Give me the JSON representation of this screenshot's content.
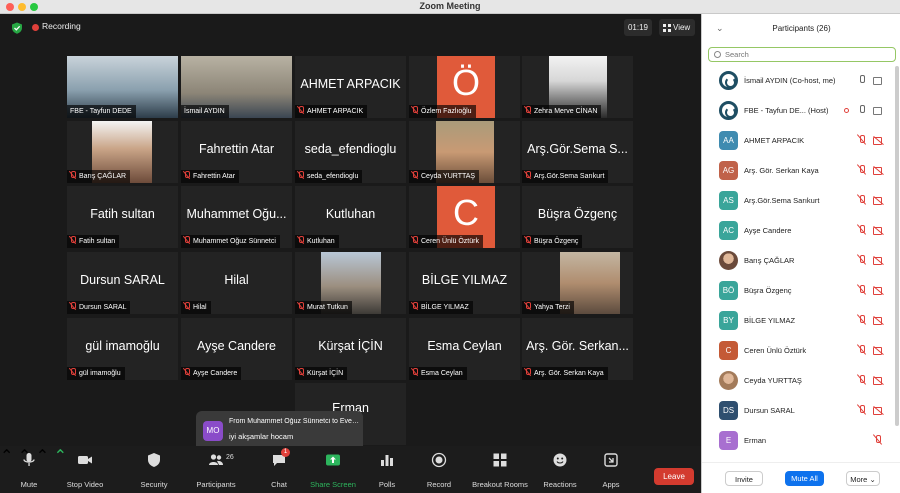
{
  "window": {
    "title": "Zoom Meeting"
  },
  "meeting": {
    "recording_label": "Recording",
    "timer": "01:19",
    "view_label": "View"
  },
  "tiles": [
    {
      "label": "FBE - Tayfun DEDE",
      "big": "",
      "type": "photo",
      "muted": false
    },
    {
      "label": "İsmail AYDIN",
      "big": "",
      "type": "photo",
      "muted": false,
      "speaking": true
    },
    {
      "label": "AHMET ARPACIK",
      "big": "AHMET ARPACIK",
      "type": "name",
      "muted": true
    },
    {
      "label": "Özlem Fazlıoğlu",
      "big": "Ö",
      "type": "letter",
      "muted": true
    },
    {
      "label": "Zehra Merve CİNAN",
      "big": "",
      "type": "photo",
      "muted": true
    },
    {
      "label": "Barış ÇAĞLAR",
      "big": "",
      "type": "photo",
      "muted": true
    },
    {
      "label": "Fahrettin Atar",
      "big": "Fahrettin Atar",
      "type": "name",
      "muted": true
    },
    {
      "label": "seda_efendioglu",
      "big": "seda_efendioglu",
      "type": "name",
      "muted": true
    },
    {
      "label": "Ceyda YURTTAŞ",
      "big": "",
      "type": "photo",
      "muted": true
    },
    {
      "label": "Arş.Gör.Sema Sarıkurt",
      "big": "Arş.Gör.Sema S...",
      "type": "name",
      "muted": true
    },
    {
      "label": "Fatih sultan",
      "big": "Fatih sultan",
      "type": "name",
      "muted": true
    },
    {
      "label": "Muhammet Oğuz Sünnetci",
      "big": "Muhammet Oğu...",
      "type": "name",
      "muted": true
    },
    {
      "label": "Kutluhan",
      "big": "Kutluhan",
      "type": "name",
      "muted": true
    },
    {
      "label": "Ceren Ünlü Öztürk",
      "big": "C",
      "type": "letter",
      "muted": true
    },
    {
      "label": "Büşra Özgenç",
      "big": "Büşra Özgenç",
      "type": "name",
      "muted": true
    },
    {
      "label": "Dursun SARAL",
      "big": "Dursun SARAL",
      "type": "name",
      "muted": true
    },
    {
      "label": "Hilal",
      "big": "Hilal",
      "type": "name",
      "muted": true
    },
    {
      "label": "Murat Tutkun",
      "big": "",
      "type": "photo",
      "muted": true
    },
    {
      "label": "BİLGE  YILMAZ",
      "big": "BİLGE  YILMAZ",
      "type": "name",
      "muted": true
    },
    {
      "label": "Yahya Terzi",
      "big": "",
      "type": "photo",
      "muted": true
    },
    {
      "label": "gül imamoğlu",
      "big": "gül imamoğlu",
      "type": "name",
      "muted": true
    },
    {
      "label": "Ayşe Candere",
      "big": "Ayşe Candere",
      "type": "name",
      "muted": true
    },
    {
      "label": "Kürşat İÇİN",
      "big": "Kürşat İÇİN",
      "type": "name",
      "muted": true
    },
    {
      "label": "Esma Ceylan",
      "big": "Esma Ceylan",
      "type": "name",
      "muted": true
    },
    {
      "label": "Arş. Gör. Serkan Kaya",
      "big": "Arş. Gör. Serkan...",
      "type": "name",
      "muted": true
    },
    {
      "label": "",
      "big": "Erman",
      "type": "name",
      "muted": false
    }
  ],
  "toast": {
    "avatar": "MO",
    "from": "From Muhammet Oğuz Sünnetci to Everyone",
    "message": "iyi akşamlar hocam"
  },
  "toolbar": {
    "mute": "Mute",
    "stop_video": "Stop Video",
    "security": "Security",
    "participants": "Participants",
    "participants_count": "26",
    "chat": "Chat",
    "chat_badge": "1",
    "share_screen": "Share Screen",
    "polls": "Polls",
    "record": "Record",
    "breakout": "Breakout Rooms",
    "reactions": "Reactions",
    "apps": "Apps",
    "leave": "Leave"
  },
  "panel": {
    "title": "Participants (26)",
    "search_placeholder": "Search",
    "participants": [
      {
        "name": "İsmail AYDIN (Co-host, me)",
        "avatar": "",
        "color": "#1f4e63",
        "style": "ring",
        "mic": "on",
        "cam": "on"
      },
      {
        "name": "FBE - Tayfun DE...  (Host)",
        "avatar": "",
        "color": "#1f4e63",
        "style": "ring",
        "mic": "on",
        "cam": "on",
        "recording": true
      },
      {
        "name": "AHMET ARPACIK",
        "avatar": "AA",
        "color": "#3f8bb0",
        "style": "square",
        "mic": "off",
        "cam": "off"
      },
      {
        "name": "Arş. Gör. Serkan Kaya",
        "avatar": "AG",
        "color": "#c0624a",
        "style": "square",
        "mic": "off",
        "cam": "off"
      },
      {
        "name": "Arş.Gör.Sema Sarıkurt",
        "avatar": "AS",
        "color": "#3aa59a",
        "style": "square",
        "mic": "off",
        "cam": "off"
      },
      {
        "name": "Ayşe Candere",
        "avatar": "AC",
        "color": "#3aa59a",
        "style": "square",
        "mic": "off",
        "cam": "off"
      },
      {
        "name": "Barış ÇAĞLAR",
        "avatar": "",
        "color": "#6b4a3a",
        "style": "photo",
        "mic": "off",
        "cam": "off"
      },
      {
        "name": "Büşra Özgenç",
        "avatar": "BÖ",
        "color": "#3aa59a",
        "style": "square",
        "mic": "off",
        "cam": "off"
      },
      {
        "name": "BİLGE  YILMAZ",
        "avatar": "BY",
        "color": "#3aa59a",
        "style": "square",
        "mic": "off",
        "cam": "off"
      },
      {
        "name": "Ceren Ünlü Öztürk",
        "avatar": "C",
        "color": "#c45a36",
        "style": "square",
        "mic": "off",
        "cam": "off"
      },
      {
        "name": "Ceyda YURTTAŞ",
        "avatar": "",
        "color": "#a37b5a",
        "style": "photo",
        "mic": "off",
        "cam": "off"
      },
      {
        "name": "Dursun SARAL",
        "avatar": "DS",
        "color": "#2f4f6f",
        "style": "square",
        "mic": "off",
        "cam": "off"
      },
      {
        "name": "Erman",
        "avatar": "E",
        "color": "#a86fd0",
        "style": "square",
        "mic": "off",
        "cam": "none"
      }
    ],
    "invite": "Invite",
    "mute_all": "Mute All",
    "more": "More"
  }
}
